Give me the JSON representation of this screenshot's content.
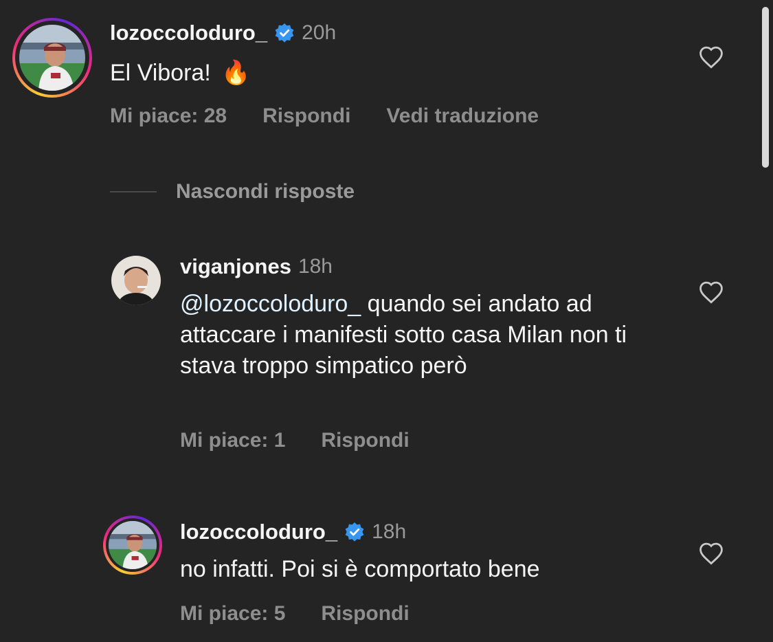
{
  "comments": [
    {
      "username": "lozoccoloduro_",
      "verified": true,
      "time": "20h",
      "text": "El Vibora!",
      "emoji": "🔥",
      "likes_label": "Mi piace: 28",
      "reply_label": "Rispondi",
      "translate_label": "Vedi traduzione",
      "story_ring": true
    }
  ],
  "hide_replies_label": "Nascondi risposte",
  "replies": [
    {
      "username": "viganjones",
      "verified": false,
      "time": "18h",
      "mention": "@lozoccoloduro_",
      "text": " quando sei andato ad attaccare i manifesti sotto casa Milan non ti stava troppo simpatico però",
      "likes_label": "Mi piace: 1",
      "reply_label": "Rispondi",
      "story_ring": false
    },
    {
      "username": "lozoccoloduro_",
      "verified": true,
      "time": "18h",
      "text": "no infatti. Poi si è comportato bene",
      "likes_label": "Mi piace: 5",
      "reply_label": "Rispondi",
      "story_ring": true
    }
  ],
  "icons": {
    "like": "heart-outline-icon",
    "verified": "verified-badge-icon"
  },
  "colors": {
    "background": "#242424",
    "verified": "#3797f0",
    "mention": "#e0f1ff",
    "secondary_text": "#8e8e8e"
  }
}
